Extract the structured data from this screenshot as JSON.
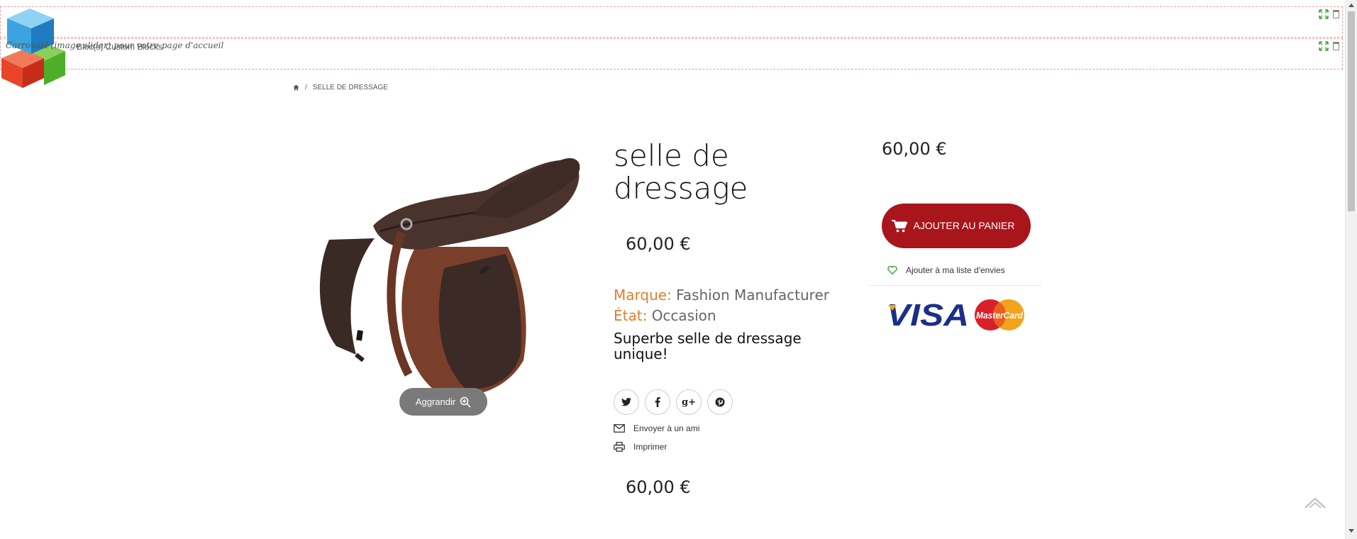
{
  "editor": {
    "block1_label": "Carrousel (image slider) pour votre page d'accueil",
    "block2_label": "Bloc(s) Custom Blocks"
  },
  "breadcrumb": {
    "current": "SELLE DE DRESSAGE"
  },
  "product": {
    "title": "selle de dressage",
    "price": "60,00 €",
    "brand_label": "Marque:",
    "brand_value": "Fashion Manufacturer",
    "condition_label": "État:",
    "condition_value": "Occasion",
    "description": "Superbe selle de dressage unique!",
    "zoom_label": "Aggrandir"
  },
  "share": {
    "icons": [
      "twitter-icon",
      "facebook-icon",
      "google-plus-icon",
      "pinterest-icon"
    ],
    "send_friend": "Envoyer à un ami",
    "print": "Imprimer"
  },
  "buy_box": {
    "price": "60,00 €",
    "add_to_cart": "AJOUTER AU PANIER",
    "wishlist": "Ajouter à ma liste d'envies",
    "payment_logos": "VISA MasterCard"
  },
  "colors": {
    "accent_red": "#a8151b",
    "label_orange": "#e07f2b",
    "wishlist_green": "#3aa335"
  }
}
